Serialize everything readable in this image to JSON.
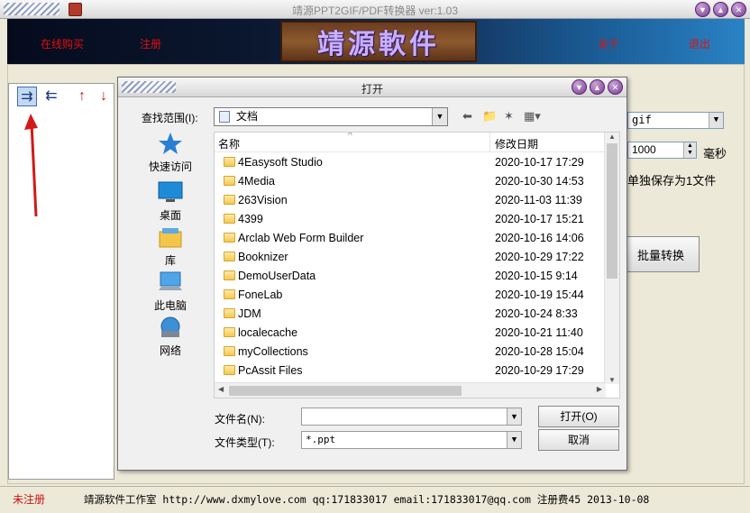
{
  "main": {
    "title": "靖源PPT2GIF/PDF转换器 ver:1.03",
    "menu": {
      "buy": "在线购买",
      "register": "注册",
      "about": "关于",
      "exit": "退出"
    },
    "logo_text": "靖源軟件",
    "right_panel": {
      "format_value": "gif",
      "delay_value": "1000",
      "delay_unit": "毫秒",
      "save_option": "单独保存为1文件",
      "batch_button": "批量转换"
    },
    "status": {
      "unregistered": "未注册",
      "info": "靖源软件工作室 http://www.dxmylove.com qq:171833017 email:171833017@qq.com 注册费45 2013-10-08"
    }
  },
  "dialog": {
    "title": "打开",
    "look_in_label": "查找范围(I):",
    "look_in_value": "文档",
    "places": [
      "快速访问",
      "桌面",
      "库",
      "此电脑",
      "网络"
    ],
    "columns": {
      "name": "名称",
      "modified": "修改日期"
    },
    "files": [
      {
        "name": "4Easysoft Studio",
        "date": "2020-10-17 17:29"
      },
      {
        "name": "4Media",
        "date": "2020-10-30 14:53"
      },
      {
        "name": "263Vision",
        "date": "2020-11-03 11:39"
      },
      {
        "name": "4399",
        "date": "2020-10-17 15:21"
      },
      {
        "name": "Arclab Web Form Builder",
        "date": "2020-10-16 14:06"
      },
      {
        "name": "Booknizer",
        "date": "2020-10-29 17:22"
      },
      {
        "name": "DemoUserData",
        "date": "2020-10-15 9:14"
      },
      {
        "name": "FoneLab",
        "date": "2020-10-19 15:44"
      },
      {
        "name": "JDM",
        "date": "2020-10-24 8:33"
      },
      {
        "name": "localecache",
        "date": "2020-10-21 11:40"
      },
      {
        "name": "myCollections",
        "date": "2020-10-28 15:04"
      },
      {
        "name": "PcAssit Files",
        "date": "2020-10-29 17:29"
      }
    ],
    "filename_label": "文件名(N):",
    "filename_value": "",
    "filetype_label": "文件类型(T):",
    "filetype_value": "*.ppt",
    "open_button": "打开(O)",
    "cancel_button": "取消"
  },
  "colors": {
    "menu_red": "#e01010",
    "logo_text": "#c8b0ff",
    "status_red": "#d01010"
  }
}
